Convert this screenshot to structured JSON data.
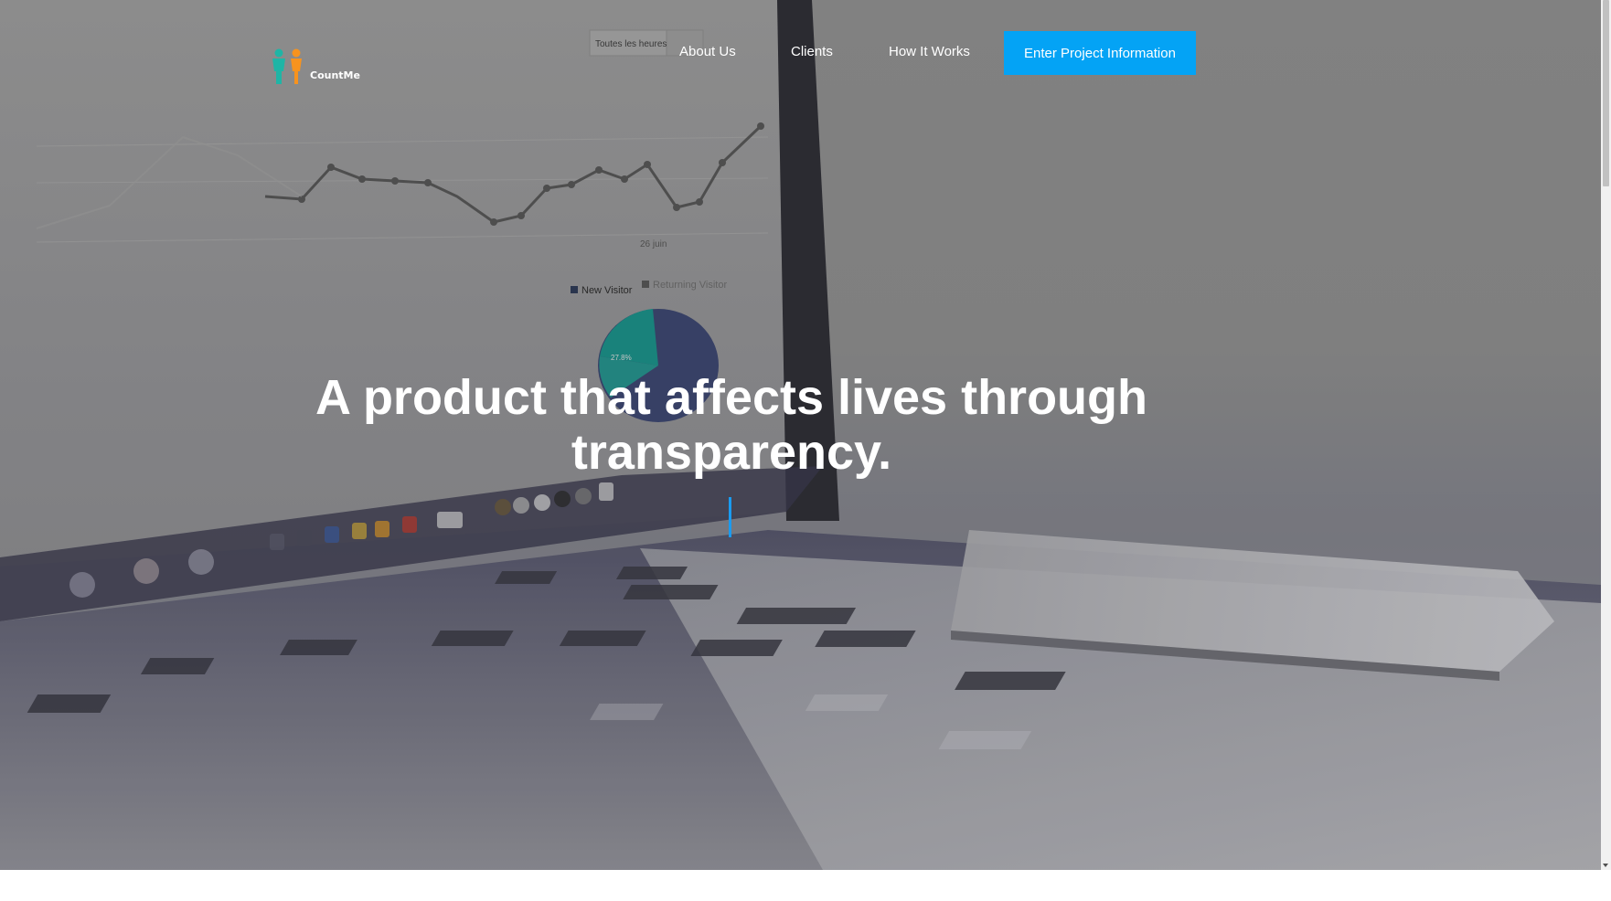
{
  "brand": {
    "name": "CountMe",
    "icon_left_color": "#1fb5a6",
    "icon_right_color": "#f7931e"
  },
  "nav": {
    "items": [
      {
        "label": "About Us"
      },
      {
        "label": "Clients"
      },
      {
        "label": "How It Works"
      }
    ],
    "cta_label": "Enter Project Information"
  },
  "hero": {
    "headline": "A product that affects lives through transparency.",
    "background_image": {
      "description_icon": "laptop-analytics-photo",
      "screen_labels": {
        "tab": "Toutes les heures",
        "date": "26 juin",
        "legend_new": "New Visitor",
        "legend_returning": "Returning Visitor",
        "pie_pct": "27.8%"
      }
    }
  },
  "colors": {
    "accent": "#04a3f5",
    "cursor": "#1a9bf0",
    "text": "#ffffff"
  }
}
